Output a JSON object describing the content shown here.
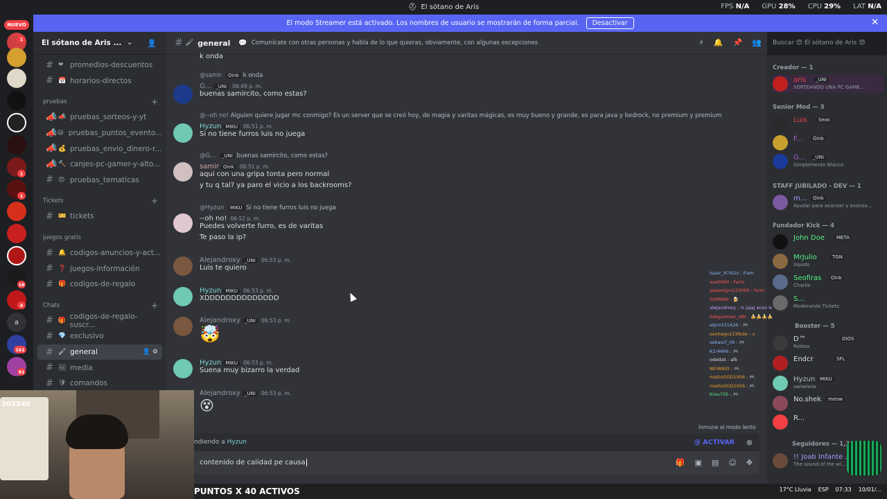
{
  "titlebar": {
    "title": "El sótano de Aris",
    "fps_label": "FPS",
    "fps_value": "N/A",
    "gpu_label": "GPU",
    "gpu_value": "28%",
    "cpu_label": "CPU",
    "cpu_value": "29%",
    "lat_label": "LAT",
    "lat_value": "N/A"
  },
  "banner": {
    "text": "El modo Streamer está activado. Los nombres de usuario se mostrarán de forma parcial.",
    "button": "Desactivar"
  },
  "guilds": {
    "new_label": "NUEVO",
    "badges": [
      "1",
      "1",
      "1",
      "70",
      "1",
      "16",
      "4",
      "161",
      "91"
    ],
    "letter": "a"
  },
  "server": {
    "name": "El sótano de Aris ...",
    "channels": [
      {
        "emoji": "❤",
        "name": "promedios-descuentos"
      },
      {
        "emoji": "📅",
        "name": "horarios-directos"
      }
    ],
    "categories": [
      {
        "name": "pruebas",
        "channels": [
          {
            "emoji": "📣",
            "name": "pruebas_sorteos-y-yt"
          },
          {
            "emoji": "😃",
            "name": "pruebas_puntos_evento..."
          },
          {
            "emoji": "💰",
            "name": "pruebas_envio_dinero-r..."
          },
          {
            "emoji": "🔨",
            "name": "canjes-pc-gamer-y-alto..."
          },
          {
            "emoji": "😍",
            "name": "pruebas_tematicas"
          }
        ]
      },
      {
        "name": "Tickets",
        "channels": [
          {
            "emoji": "🎫",
            "name": "tickets"
          }
        ]
      },
      {
        "name": "juegos gratis",
        "channels": [
          {
            "emoji": "🔔",
            "name": "codigos-anuncios-y-act..."
          },
          {
            "emoji": "❓",
            "name": "juegos-información"
          },
          {
            "emoji": "🎁",
            "name": "codigos-de-regalo"
          }
        ]
      },
      {
        "name": "Chats",
        "channels": [
          {
            "emoji": "🎁",
            "name": "codigos-de-regalo-suscr..."
          },
          {
            "emoji": "💎",
            "name": "exclusivo"
          },
          {
            "emoji": "🖌",
            "name": "general"
          },
          {
            "emoji": "🖼",
            "name": "media"
          },
          {
            "emoji": "🛡",
            "name": "comandos"
          },
          {
            "emoji": "😂",
            "name": "memes"
          }
        ]
      }
    ]
  },
  "channel_header": {
    "name": "general",
    "topic": "Comunícate con otras personas y habla de lo que quieras, obviamente, con algunas excepciones",
    "search_placeholder": "Buscar 😍 El sótano de Aris 😍"
  },
  "messages": [
    {
      "text": "k onda"
    },
    {
      "reply_author": "@samir",
      "reply_tag": "Oink",
      "reply_text": "k onda",
      "author": "G...",
      "tag": "_UNI",
      "time": "06:49 p. m.",
      "text": "buenas samircito, como estas?"
    },
    {
      "reply_author": "@--oh no!",
      "reply_text": "Alguien quiere jugar mc conmigo? Es un server que se creó hoy,  de magia y varitas mágicas, es muy bueno y grande, es para java y bedrock, no premium y premium",
      "author": "Hyzun",
      "tag": "MIKU",
      "time": "06:51 p. m.",
      "text": "Si no tiene furros luis no juega"
    },
    {
      "reply_author": "@G...",
      "reply_tag": "_UNI",
      "reply_text": "buenas samircito, como estas?",
      "author": "samir",
      "tag": "Oink",
      "time": "06:51 p. m.",
      "text": "aqui con una gripa tonta pero normal",
      "text2": "y tu q tal? ya paro el vicio a los backrooms?"
    },
    {
      "reply_author": "@Hyzun",
      "reply_tag": "MIKU",
      "reply_text": "Si no tiene furros luis no juega",
      "author": "--oh no!",
      "time": "06:52 p. m.",
      "text": "Puedes volverte furro, es de varitas",
      "text2": "Te paso la ip?"
    },
    {
      "author": "Alejandroxy",
      "tag": "_UNI",
      "time": "06:53 p. m.",
      "text": "Luis te quiero"
    },
    {
      "author": "Hyzun",
      "tag": "MIKU",
      "time": "06:53 p. m.",
      "text": "XDDDDDDDDDDDDDD"
    },
    {
      "author": "Alejandroxy",
      "tag": "_UNI",
      "time": "06:53 p. m.",
      "text": "🤯"
    },
    {
      "author": "Hyzun",
      "tag": "MIKU",
      "time": "06:53 p. m.",
      "text": "Suena muy bizarro la verdad"
    },
    {
      "author": "Alejandroxy",
      "tag": "_UNI",
      "time": "06:53 p. m.",
      "text": "😵"
    }
  ],
  "slowmode": "Inmune al modo lento",
  "composer": {
    "replying_prefix": "ndiendo a",
    "replying_to": "Hyzun",
    "activar": "@ ACTIVAR",
    "value": "contenido de calidad pe causa"
  },
  "members": {
    "groups": [
      {
        "label": "Creador — 1"
      },
      {
        "label": "Senior Mod — 3"
      },
      {
        "label": "STAFF JUBILADO - DEV — 1"
      },
      {
        "label": "Fundador Kick — 4"
      },
      {
        "label": "Booster — 5"
      },
      {
        "label": "Seguidores — 1,322"
      }
    ],
    "list": [
      {
        "name": "aris",
        "tag": "_UNI",
        "sub": "SORTEANDO UNA PC GAME..."
      },
      {
        "name": "Luis",
        "tag": "Sexo",
        "sub": ""
      },
      {
        "name": "F...",
        "tag": "Oink",
        "sub": ""
      },
      {
        "name": "G...",
        "tag": "_UNI",
        "sub": "Simplemente Blanco"
      },
      {
        "name": "m...",
        "tag": "Oink",
        "sub": "Ayudar para avanzar y avanza..."
      },
      {
        "name": "John Doe",
        "tag": "META",
        "sub": ""
      },
      {
        "name": "MrJulio",
        "tag": "TGN",
        "sub": "liquido"
      },
      {
        "name": "Seofiras",
        "tag": "Oink",
        "sub": "Charlie"
      },
      {
        "name": "S...",
        "tag": "",
        "sub": "Moderando Tickets"
      },
      {
        "name": "D™",
        "tag": "DIOS",
        "sub": "Roblox"
      },
      {
        "name": "Endcr",
        "tag": "SFL",
        "sub": ""
      },
      {
        "name": "Hyzun",
        "tag": "MIKU",
        "sub": "awiwiwiw"
      },
      {
        "name": "No.shek",
        "tag": "meow",
        "sub": ""
      },
      {
        "name": "R...",
        "tag": "",
        "sub": ""
      },
      {
        "name": "!! Joab Infante ...",
        "tag": "",
        "sub": "The sound of the wi..."
      }
    ]
  },
  "stream_overlay": {
    "follower_count": "203540",
    "chat": [
      "Isaac_874i2o : fram",
      "axe0990 : Farm",
      "pepeelgro123090 : farm",
      "GIMNI99 : 🍺",
      "alejandroxy : !s jajaj enzo leyendo todo",
      "ildeguzman_UNI : 🍌🍌🍌🍌🍌",
      "elpro151426 : 🎮",
      "santiago123fede : u",
      "sebascf_09 : 🎮",
      "K1r4666 : 🎮",
      "odettet : afk",
      "NEYANIO : 🎮",
      "mattoGOD1956 : 🎮",
      "mattoGOD1956 : 🎮",
      "Krou705 : 🎮"
    ],
    "promo": "PUNTOS X 40 ACTIVOS"
  },
  "taskbar": {
    "weather": "17°C  Lluvia",
    "lang": "ESP",
    "time": "07:33",
    "date": "10/01/..."
  },
  "colors": {
    "accent": "#5865f2",
    "background": "#313338",
    "sidebar": "#2b2d31",
    "danger": "#f23f43"
  }
}
